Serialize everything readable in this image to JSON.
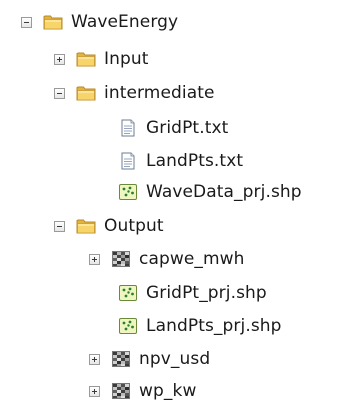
{
  "tree": {
    "root": {
      "label": "WaveEnergy",
      "icon": "folder-icon",
      "state": "expanded"
    },
    "input": {
      "label": "Input",
      "icon": "folder-icon",
      "state": "collapsed"
    },
    "intermediate": {
      "label": "intermediate",
      "icon": "folder-icon",
      "state": "expanded",
      "children": [
        {
          "label": "GridPt.txt",
          "icon": "text-file-icon"
        },
        {
          "label": "LandPts.txt",
          "icon": "text-file-icon"
        },
        {
          "label": "WaveData_prj.shp",
          "icon": "point-shapefile-icon"
        }
      ]
    },
    "output": {
      "label": "Output",
      "icon": "folder-icon",
      "state": "expanded",
      "children": [
        {
          "label": "capwe_mwh",
          "icon": "raster-icon",
          "state": "collapsed"
        },
        {
          "label": "GridPt_prj.shp",
          "icon": "point-shapefile-icon"
        },
        {
          "label": "LandPts_prj.shp",
          "icon": "point-shapefile-icon"
        },
        {
          "label": "npv_usd",
          "icon": "raster-icon",
          "state": "collapsed"
        },
        {
          "label": "wp_kw",
          "icon": "raster-icon",
          "state": "collapsed"
        }
      ]
    }
  },
  "colors": {
    "folder_front": "#f7d56b",
    "folder_back": "#e2b33f",
    "folder_edge": "#b8892a",
    "toggle_border": "#9a9a9a",
    "text": "#1a1a1a"
  }
}
